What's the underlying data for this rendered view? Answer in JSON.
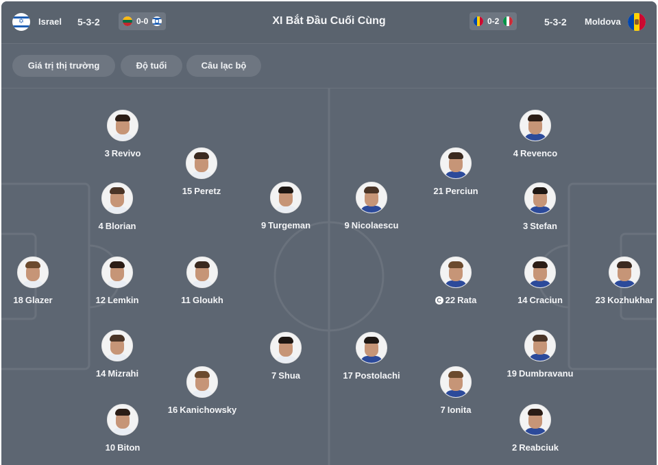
{
  "header": {
    "title": "XI Bắt Đầu Cuối Cùng",
    "home": {
      "name": "Israel",
      "formation": "5-3-2",
      "recent_score": "0-0"
    },
    "away": {
      "name": "Moldova",
      "formation": "5-3-2",
      "recent_score": "0-2"
    }
  },
  "filters": [
    "Giá trị thị trường",
    "Độ tuổi",
    "Câu lạc bộ"
  ],
  "colors": {
    "background": "#5d6672",
    "chip": "#6e7681",
    "text": "#f4f5f7"
  },
  "home_players": [
    {
      "number": "3",
      "name": "Revivo"
    },
    {
      "number": "15",
      "name": "Peretz"
    },
    {
      "number": "4",
      "name": "Blorian"
    },
    {
      "number": "9",
      "name": "Turgeman"
    },
    {
      "number": "18",
      "name": "Glazer"
    },
    {
      "number": "12",
      "name": "Lemkin"
    },
    {
      "number": "11",
      "name": "Gloukh"
    },
    {
      "number": "14",
      "name": "Mizrahi"
    },
    {
      "number": "7",
      "name": "Shua"
    },
    {
      "number": "16",
      "name": "Kanichowsky"
    },
    {
      "number": "10",
      "name": "Biton"
    }
  ],
  "away_players": [
    {
      "number": "4",
      "name": "Revenco"
    },
    {
      "number": "21",
      "name": "Perciun"
    },
    {
      "number": "9",
      "name": "Nicolaescu"
    },
    {
      "number": "3",
      "name": "Stefan"
    },
    {
      "number": "22",
      "name": "Rata",
      "captain": true
    },
    {
      "number": "14",
      "name": "Craciun"
    },
    {
      "number": "23",
      "name": "Kozhukhar"
    },
    {
      "number": "19",
      "name": "Dumbravanu"
    },
    {
      "number": "17",
      "name": "Postolachi"
    },
    {
      "number": "7",
      "name": "Ionita"
    },
    {
      "number": "2",
      "name": "Reabciuk"
    }
  ]
}
